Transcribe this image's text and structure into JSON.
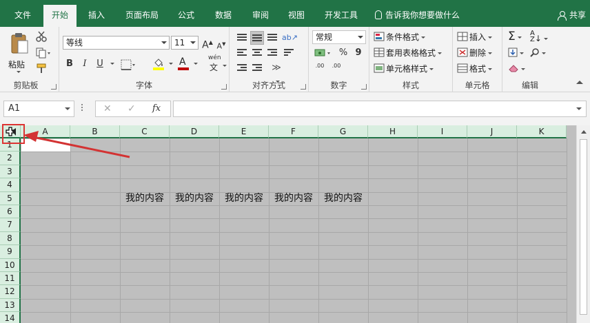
{
  "tabs": [
    {
      "label": "文件",
      "active": false
    },
    {
      "label": "开始",
      "active": true
    },
    {
      "label": "插入",
      "active": false
    },
    {
      "label": "页面布局",
      "active": false
    },
    {
      "label": "公式",
      "active": false
    },
    {
      "label": "数据",
      "active": false
    },
    {
      "label": "审阅",
      "active": false
    },
    {
      "label": "视图",
      "active": false
    },
    {
      "label": "开发工具",
      "active": false
    }
  ],
  "tell_me": "告诉我你想要做什么",
  "share": "共享",
  "clipboard": {
    "paste": "粘贴",
    "label": "剪贴板"
  },
  "font": {
    "name": "等线",
    "size": "11",
    "increase": "A",
    "decrease": "A",
    "bold": "B",
    "italic": "I",
    "underline": "U",
    "font_color_glyph": "A",
    "fill_glyph": "A",
    "wen": "wén",
    "wen_char": "文",
    "label": "字体"
  },
  "alignment": {
    "label": "对齐方式"
  },
  "number": {
    "format": "常规",
    "percent": "%",
    "comma": "9",
    "label": "数字",
    "inc_dec": ".00",
    "dec_dec": ".00"
  },
  "styles": {
    "conditional": "条件格式",
    "table": "套用表格格式",
    "cell": "单元格样式",
    "label": "样式"
  },
  "cells": {
    "insert": "插入",
    "delete": "删除",
    "format": "格式",
    "label": "单元格"
  },
  "editing": {
    "label": "编辑",
    "sum": "Σ"
  },
  "formula_bar": {
    "name_box": "A1",
    "fx": "fx",
    "value": ""
  },
  "columns": [
    "A",
    "B",
    "C",
    "D",
    "E",
    "F",
    "G",
    "H",
    "I",
    "J",
    "K"
  ],
  "rows": [
    "1",
    "2",
    "3",
    "4",
    "5",
    "6",
    "7",
    "8",
    "9",
    "10",
    "11",
    "12",
    "13",
    "14"
  ],
  "row5_cells": [
    "我的内容",
    "我的内容",
    "我的内容",
    "我的内容",
    "我的内容"
  ],
  "colors": {
    "ribbon_green": "#217346",
    "selection_grey": "#bfbfbf",
    "highlight_red": "#d33333",
    "font_color_bar": "#c00000",
    "fill_color_bar": "#ffff00"
  }
}
